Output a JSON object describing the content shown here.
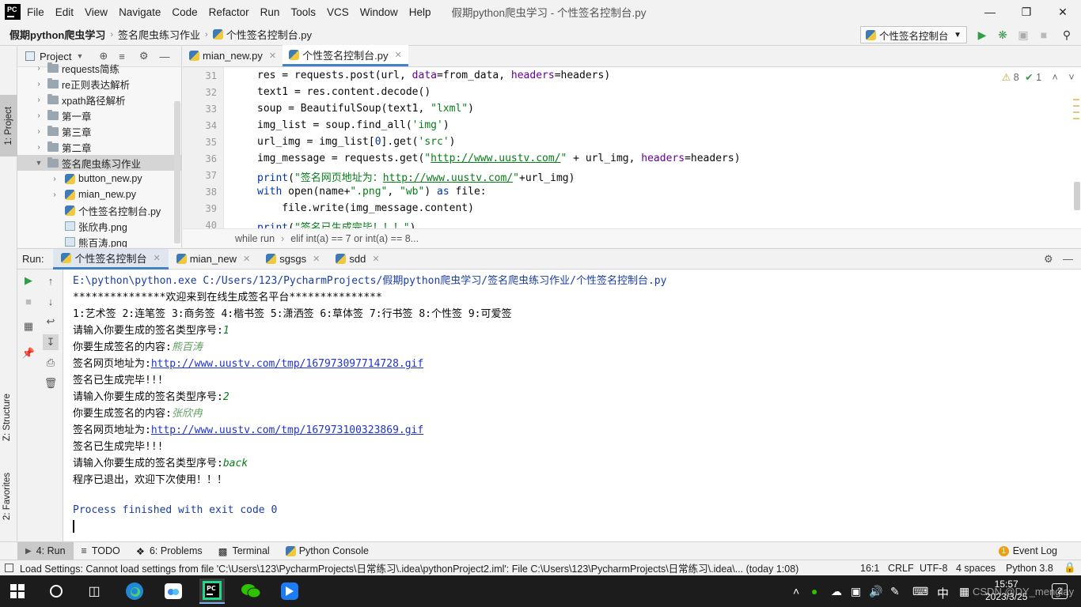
{
  "app": {
    "logo": "PC",
    "window_title": "假期python爬虫学习 - 个性签名控制台.py"
  },
  "menu": [
    "File",
    "Edit",
    "View",
    "Navigate",
    "Code",
    "Refactor",
    "Run",
    "Tools",
    "VCS",
    "Window",
    "Help"
  ],
  "nav": {
    "crumbs": [
      "假期python爬虫学习",
      "签名爬虫练习作业",
      "个性签名控制台.py"
    ],
    "run_config": "个性签名控制台"
  },
  "left_stripe": {
    "project": "1: Project",
    "structure": "Z: Structure",
    "favorites": "2: Favorites"
  },
  "project_panel": {
    "title": "Project",
    "items": [
      {
        "label": "requests简练",
        "expanded": false,
        "type": "folder"
      },
      {
        "label": "re正则表达解析",
        "expanded": false,
        "type": "folder"
      },
      {
        "label": "xpath路径解析",
        "expanded": false,
        "type": "folder"
      },
      {
        "label": "第一章",
        "expanded": false,
        "type": "folder"
      },
      {
        "label": "第三章",
        "expanded": false,
        "type": "folder"
      },
      {
        "label": "第二章",
        "expanded": false,
        "type": "folder"
      },
      {
        "label": "签名爬虫练习作业",
        "expanded": true,
        "type": "folder"
      },
      {
        "label": "button_new.py",
        "type": "py"
      },
      {
        "label": "mian_new.py",
        "type": "py"
      },
      {
        "label": "个性签名控制台.py",
        "type": "py"
      },
      {
        "label": "张欣冉.png",
        "type": "png"
      },
      {
        "label": "熊百涛.png",
        "type": "png"
      }
    ]
  },
  "editor": {
    "tabs": [
      {
        "label": "mian_new.py",
        "active": false
      },
      {
        "label": "个性签名控制台.py",
        "active": true
      }
    ],
    "inspections": {
      "warnings": "8",
      "ok": "1"
    },
    "line_numbers": [
      "31",
      "32",
      "33",
      "34",
      "35",
      "36",
      "37",
      "38",
      "39",
      "40"
    ],
    "breadcrumb": [
      "while run",
      "elif int(a) == 7 or int(a) == 8..."
    ]
  },
  "run": {
    "label": "Run:",
    "tabs": [
      "个性签名控制台",
      "mian_new",
      "sgsgs",
      "sdd"
    ],
    "console": {
      "command": "E:\\python\\python.exe C:/Users/123/PycharmProjects/假期python爬虫学习/签名爬虫练习作业/个性签名控制台.py",
      "welcome": "***************欢迎来到在线生成签名平台***************",
      "menu": "1:艺术签 2:连笔签 3:商务签 4:楷书签 5:潇洒签 6:草体签 7:行书签 8:个性签 9:可爱签",
      "prompt_type": "请输入你要生成的签名类型序号:",
      "prompt_content": "你要生成签名的内容:",
      "url_prefix": "签名网页地址为:",
      "done": "签名已生成完毕!!!",
      "input1": "1",
      "name1": "熊百涛",
      "url1": "http://www.uustv.com/tmp/167973097714728.gif",
      "input2": "2",
      "name2": "张欣冉",
      "url2": "http://www.uustv.com/tmp/167973100323869.gif",
      "input3": "back",
      "exit_msg": "程序已退出，欢迎下次使用！！！",
      "finished": "Process finished with exit code 0"
    }
  },
  "bottom_tabs": {
    "run": "4: Run",
    "todo": "TODO",
    "problems": "6: Problems",
    "terminal": "Terminal",
    "python_console": "Python Console",
    "event_log": "Event Log",
    "event_count": "1"
  },
  "status": {
    "message": "Load Settings: Cannot load settings from file 'C:\\Users\\123\\PycharmProjects\\日常练习\\.idea\\pythonProject2.iml': File C:\\Users\\123\\PycharmProjects\\日常练习\\.idea\\... (today 1:08)",
    "position": "16:1",
    "line_sep": "CRLF",
    "encoding": "UTF-8",
    "indent": "4 spaces",
    "interpreter": "Python 3.8"
  },
  "taskbar": {
    "ime": "中",
    "time": "15:57",
    "date": "2023/3/25",
    "notifications": "2",
    "watermark": "CSDN @DY_menglay"
  },
  "colors": {
    "accent": "#4083c9",
    "keyword": "#0033b3",
    "string": "#067d17",
    "link": "#1f33c9",
    "run_green": "#2f9e44"
  }
}
